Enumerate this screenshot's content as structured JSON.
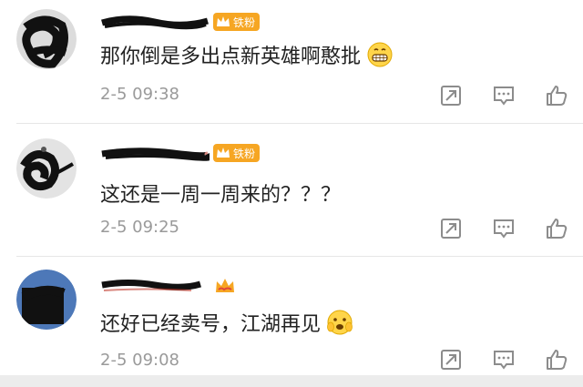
{
  "comments": [
    {
      "badge": "铁粉",
      "text": "那你倒是多出点新英雄啊憨批",
      "time": "2-5 09:38",
      "emoji": "grin-icon"
    },
    {
      "badge": "铁粉",
      "text": "这还是一周一周来的？？？",
      "time": "2-5 09:25"
    },
    {
      "text": "还好已经卖号，江湖再见",
      "time": "2-5 09:08",
      "emoji": "scared-icon"
    }
  ],
  "colors": {
    "badge": "#f6a623",
    "meta": "#9a9a9a",
    "text": "#222222"
  }
}
